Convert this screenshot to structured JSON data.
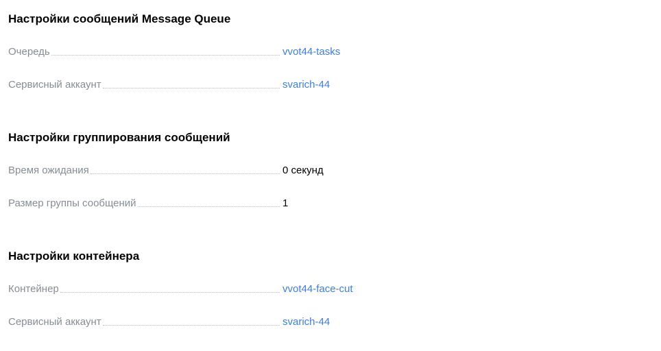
{
  "sections": [
    {
      "title": "Настройки сообщений Message Queue",
      "rows": [
        {
          "label": "Очередь",
          "value": "vvot44-tasks"
        },
        {
          "label": "Сервисный аккаунт",
          "value": "svarich-44"
        }
      ]
    },
    {
      "title": "Настройки группирования сообщений",
      "rows": [
        {
          "label": "Время ожидания",
          "value": "0 секунд"
        },
        {
          "label": "Размер группы сообщений",
          "value": "1"
        }
      ]
    },
    {
      "title": "Настройки контейнера",
      "rows": [
        {
          "label": "Контейнер",
          "value": "vvot44-face-cut"
        },
        {
          "label": "Сервисный аккаунт",
          "value": "svarich-44"
        }
      ]
    }
  ],
  "colors": {
    "link": "#3d7ee9",
    "label": "#878d93",
    "title": "#000000",
    "value_text": "#000000",
    "dots": "#b9bec3"
  }
}
